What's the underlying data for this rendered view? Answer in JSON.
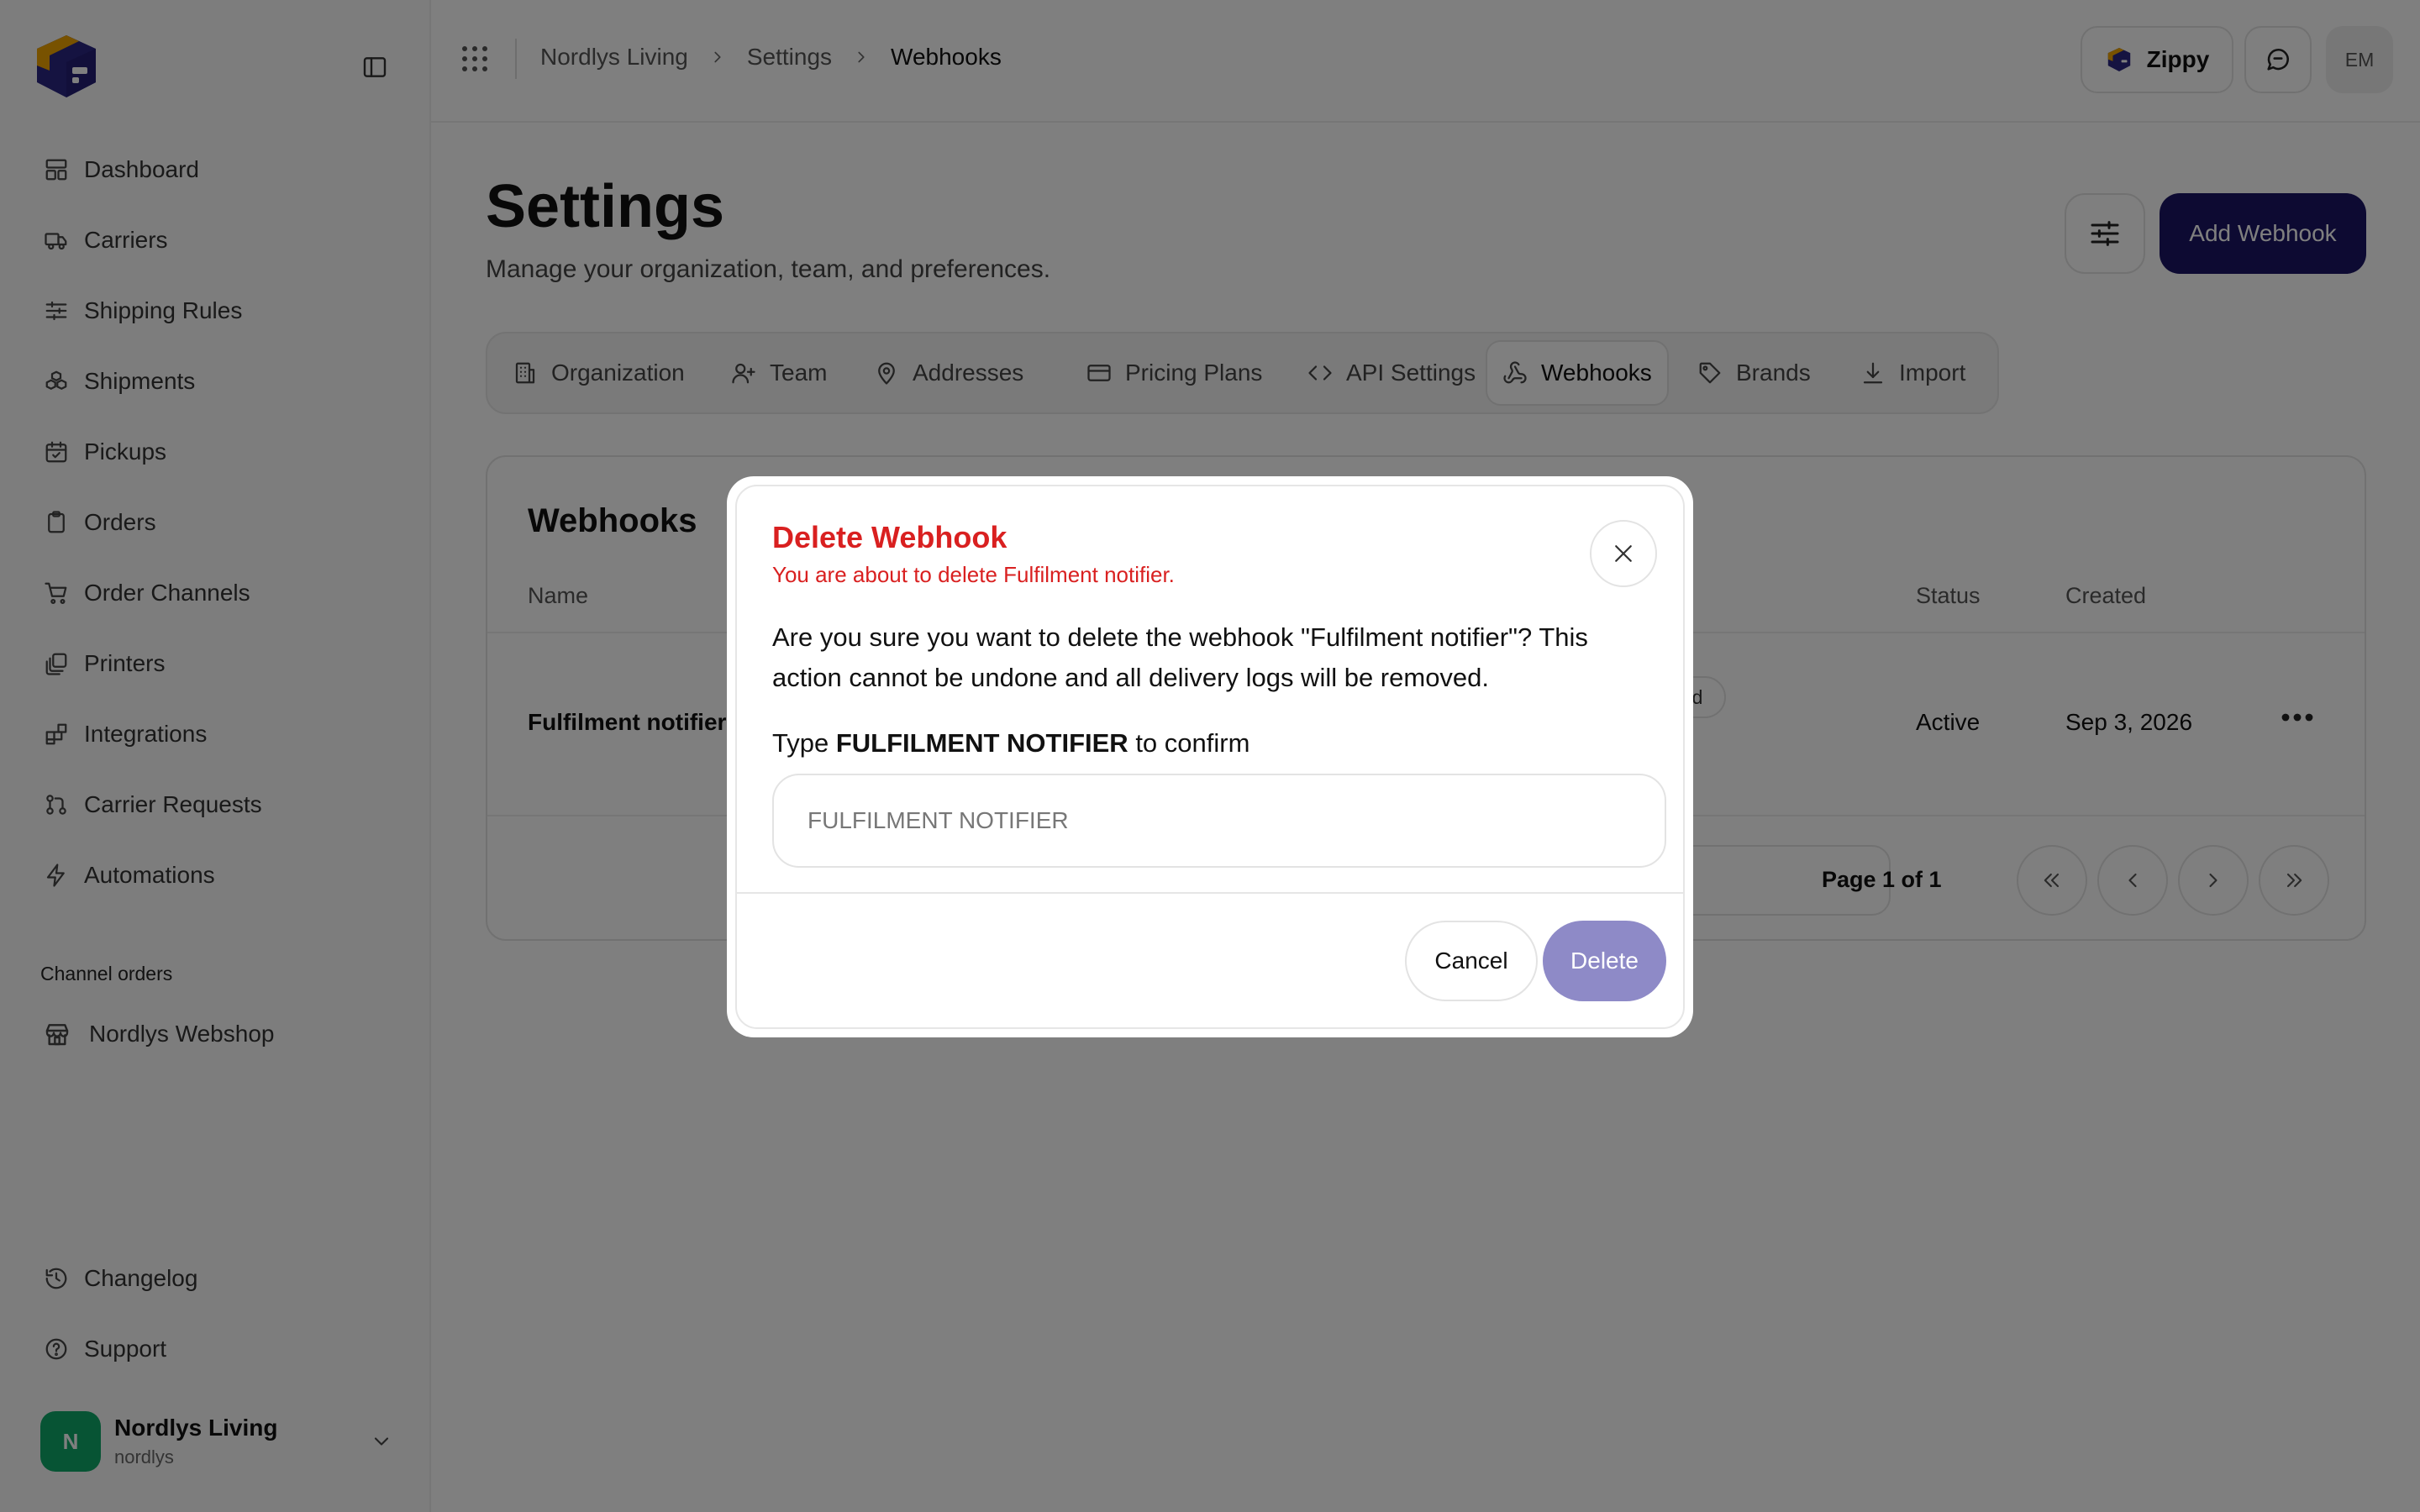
{
  "sidebar": {
    "logo_icon": "zippy-box-logo",
    "collapse_icon": "sidebar-toggle-icon",
    "items": [
      {
        "label": "Dashboard",
        "icon": "layout-dashboard-icon"
      },
      {
        "label": "Carriers",
        "icon": "truck-icon"
      },
      {
        "label": "Shipping Rules",
        "icon": "sliders-icon"
      },
      {
        "label": "Shipments",
        "icon": "boxes-icon"
      },
      {
        "label": "Pickups",
        "icon": "calendar-check-icon"
      },
      {
        "label": "Orders",
        "icon": "clipboard-icon"
      },
      {
        "label": "Order Channels",
        "icon": "shopping-cart-icon"
      },
      {
        "label": "Printers",
        "icon": "printer-stack-icon"
      },
      {
        "label": "Integrations",
        "icon": "blocks-icon"
      },
      {
        "label": "Carrier Requests",
        "icon": "git-pull-request-icon"
      },
      {
        "label": "Automations",
        "icon": "zap-icon"
      }
    ],
    "section_label": "Channel orders",
    "shop": {
      "label": "Nordlys Webshop",
      "icon": "store-icon"
    },
    "bottom_items": [
      {
        "label": "Changelog",
        "icon": "history-icon"
      },
      {
        "label": "Support",
        "icon": "help-circle-icon"
      }
    ],
    "user": {
      "initial": "N",
      "name": "Nordlys Living",
      "handle": "nordlys",
      "color": "#0fa968"
    }
  },
  "header": {
    "breadcrumb": [
      "Nordlys Living",
      "Settings",
      "Webhooks"
    ],
    "zippy_label": "Zippy",
    "avatar_initials": "EM"
  },
  "main": {
    "title": "Settings",
    "subtitle": "Manage your organization, team, and preferences.",
    "add_button": "Add Webhook",
    "tabs": [
      {
        "label": "Organization",
        "icon": "building-icon"
      },
      {
        "label": "Team",
        "icon": "user-plus-icon"
      },
      {
        "label": "Addresses",
        "icon": "map-pin-icon"
      },
      {
        "label": "Pricing Plans",
        "icon": "credit-card-icon"
      },
      {
        "label": "API Settings",
        "icon": "code-icon"
      },
      {
        "label": "Webhooks",
        "icon": "webhook-icon",
        "active": true
      },
      {
        "label": "Brands",
        "icon": "tag-icon"
      },
      {
        "label": "Import",
        "icon": "download-icon"
      }
    ],
    "card": {
      "title": "Webhooks",
      "columns": [
        "Name",
        "Status",
        "Created"
      ],
      "rows": [
        {
          "name": "Fulfilment notifier",
          "event_badge": "hed",
          "status": "Active",
          "created": "Sep 3, 2026"
        }
      ],
      "pagination": {
        "text": "Page 1 of 1"
      }
    }
  },
  "modal": {
    "title": "Delete Webhook",
    "subtitle": "You are about to delete Fulfilment notifier.",
    "body": "Are you sure you want to delete the webhook \"Fulfilment notifier\"? This action cannot be undone and all delivery logs will be removed.",
    "confirm_prefix": "Type",
    "confirm_keyword": "FULFILMENT NOTIFIER",
    "confirm_suffix": "to confirm",
    "input_placeholder": "FULFILMENT NOTIFIER",
    "input_value": "",
    "cancel_label": "Cancel",
    "delete_label": "Delete"
  },
  "colors": {
    "brand_navy": "#1b1565",
    "danger": "#d92020",
    "delete_disabled": "#8e8ac7",
    "active_green": "#0fa968"
  }
}
